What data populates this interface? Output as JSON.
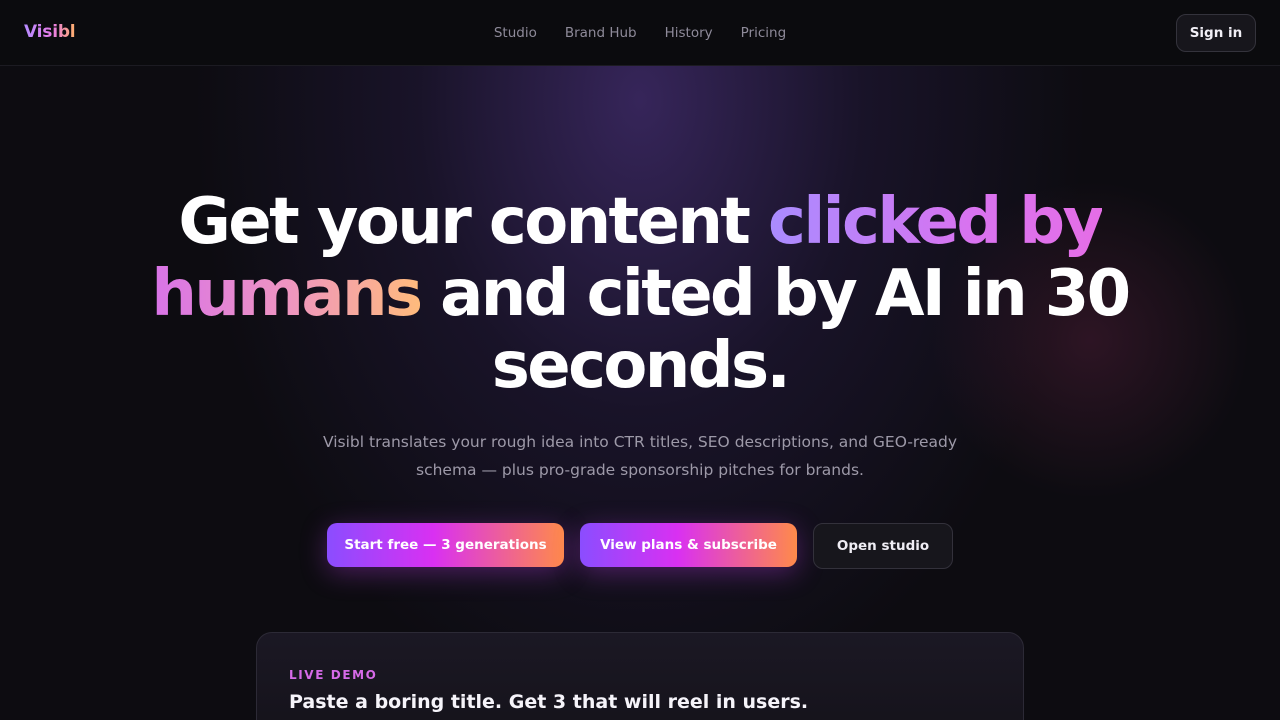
{
  "brand": {
    "logo_text": "Visibl"
  },
  "nav": {
    "links": [
      "Studio",
      "Brand Hub",
      "History",
      "Pricing"
    ],
    "signin_label": "Sign in"
  },
  "hero": {
    "headline_part1": "Get your content ",
    "headline_highlight1": "clicked by",
    "headline_highlight2": "humans",
    "headline_part2": " and cited by AI in 30 seconds.",
    "subtitle": "Visibl translates your rough idea into CTR titles, SEO descriptions, and GEO-ready schema — plus pro-grade sponsorship pitches for brands."
  },
  "cta": {
    "start_free": "Start free — 3 generations",
    "view_plans": "View plans & subscribe",
    "open_studio": "Open studio"
  },
  "demo": {
    "eyebrow": "LIVE DEMO",
    "title": "Paste a boring title. Get 3 that will reel in users."
  },
  "colors": {
    "background": "#0d0c11",
    "accent_purple": "#8b4dff",
    "accent_magenta": "#d930f2",
    "accent_orange": "#ff8a4a"
  }
}
